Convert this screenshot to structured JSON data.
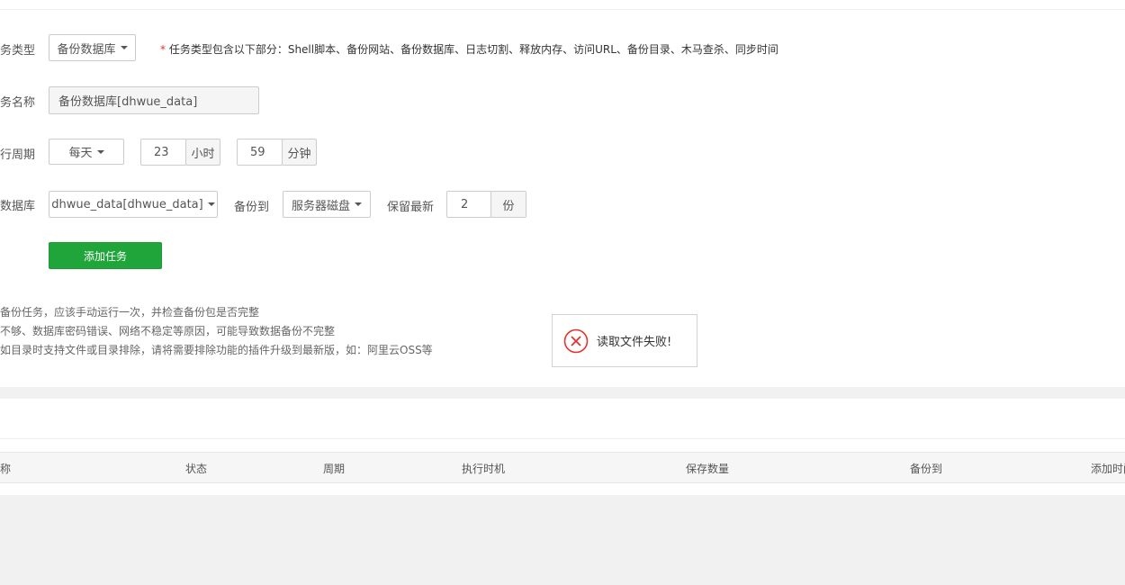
{
  "form": {
    "task_type": {
      "label": "务类型",
      "value": "备份数据库",
      "note_star": "*",
      "note": "任务类型包含以下部分：Shell脚本、备份网站、备份数据库、日志切割、释放内存、访问URL、备份目录、木马查杀、同步时间"
    },
    "task_name": {
      "label": "务名称",
      "value": "备份数据库[dhwue_data]"
    },
    "period": {
      "label": "行周期",
      "frequency": "每天",
      "hour": "23",
      "hour_unit": "小时",
      "minute": "59",
      "minute_unit": "分钟"
    },
    "database": {
      "label": "数据库",
      "value": "dhwue_data[dhwue_data]",
      "backup_to_label": "备份到",
      "backup_to": "服务器磁盘",
      "keep_label": "保留最新",
      "keep_count": "2",
      "keep_unit": "份"
    },
    "submit_label": "添加任务"
  },
  "tips": [
    "备份任务，应该手动运行一次，并检查备份包是否完整",
    "不够、数据库密码错误、网络不稳定等原因，可能导致数据备份不完整",
    "如目录时支持文件或目录排除，请将需要排除功能的插件升级到最新版，如：阿里云OSS等"
  ],
  "toast": {
    "icon": "error-circle-icon",
    "message": "读取文件失败!",
    "color": "#e0342f"
  },
  "table": {
    "headers": [
      "称",
      "状态",
      "周期",
      "执行时机",
      "保存数量",
      "备份到",
      "添加时间"
    ]
  },
  "colors": {
    "primary": "#20a53a",
    "error": "#e0342f",
    "bg": "#f1f1f1"
  }
}
